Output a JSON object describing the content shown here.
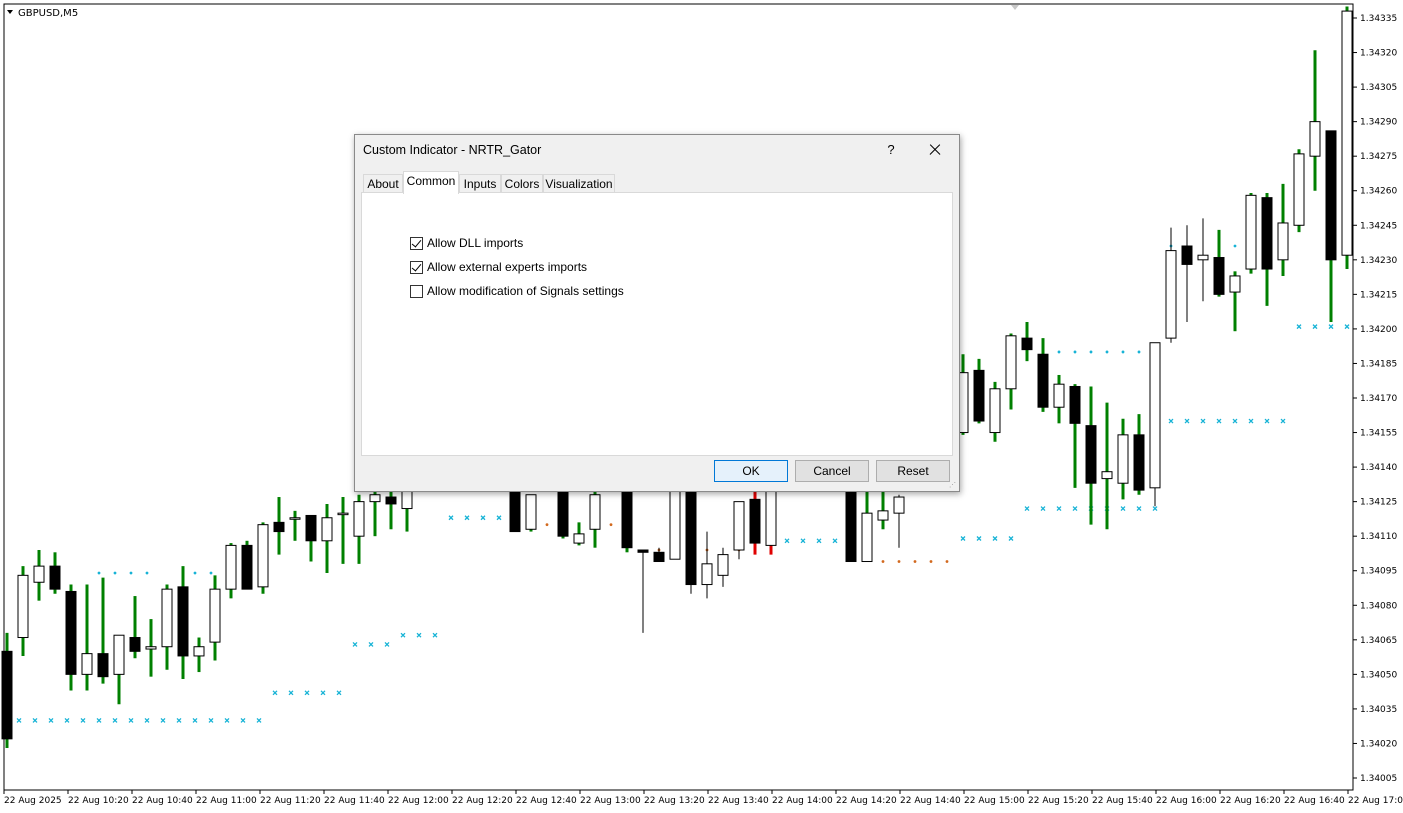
{
  "window": {
    "symbol_label": "GBPUSD,M5"
  },
  "price_axis": {
    "ticks": [
      "1.34335",
      "1.34320",
      "1.34305",
      "1.34290",
      "1.34275",
      "1.34260",
      "1.34245",
      "1.34230",
      "1.34215",
      "1.34200",
      "1.34185",
      "1.34170",
      "1.34155",
      "1.34140",
      "1.34125",
      "1.34110",
      "1.34095",
      "1.34080",
      "1.34065",
      "1.34050",
      "1.34035",
      "1.34020",
      "1.34005"
    ]
  },
  "time_axis": {
    "ticks": [
      "22 Aug 2025",
      "22 Aug 10:20",
      "22 Aug 10:40",
      "22 Aug 11:00",
      "22 Aug 11:20",
      "22 Aug 11:40",
      "22 Aug 12:00",
      "22 Aug 12:20",
      "22 Aug 12:40",
      "22 Aug 13:00",
      "22 Aug 13:20",
      "22 Aug 13:40",
      "22 Aug 14:00",
      "22 Aug 14:20",
      "22 Aug 14:40",
      "22 Aug 15:00",
      "22 Aug 15:20",
      "22 Aug 15:40",
      "22 Aug 16:00",
      "22 Aug 16:20",
      "22 Aug 16:40",
      "22 Aug 17:00"
    ]
  },
  "colors": {
    "wick_green": "#008000",
    "wick_red": "#e00000",
    "stop_marker": "#17b3d6",
    "dot_marker": "#d2691e"
  },
  "chart_data": {
    "type": "candlestick",
    "symbol": "GBPUSD",
    "timeframe": "M5",
    "ylim": [
      1.34,
      1.3434
    ],
    "candles": [
      {
        "o": 1.3406,
        "h": 1.34068,
        "l": 1.34018,
        "c": 1.34022,
        "w": "green"
      },
      {
        "o": 1.34066,
        "h": 1.34097,
        "l": 1.34058,
        "c": 1.34093,
        "w": "green"
      },
      {
        "o": 1.3409,
        "h": 1.34104,
        "l": 1.34082,
        "c": 1.34097,
        "w": "green"
      },
      {
        "o": 1.34097,
        "h": 1.34103,
        "l": 1.34085,
        "c": 1.34087,
        "w": "green"
      },
      {
        "o": 1.34086,
        "h": 1.34089,
        "l": 1.34043,
        "c": 1.3405,
        "w": "green"
      },
      {
        "o": 1.3405,
        "h": 1.34089,
        "l": 1.34043,
        "c": 1.34059,
        "w": "green"
      },
      {
        "o": 1.34059,
        "h": 1.34092,
        "l": 1.34046,
        "c": 1.34049,
        "w": "green"
      },
      {
        "o": 1.3405,
        "h": 1.34067,
        "l": 1.34037,
        "c": 1.34067,
        "w": "green"
      },
      {
        "o": 1.34066,
        "h": 1.34084,
        "l": 1.34057,
        "c": 1.3406,
        "w": "green"
      },
      {
        "o": 1.34061,
        "h": 1.34074,
        "l": 1.34049,
        "c": 1.34062,
        "w": "green"
      },
      {
        "o": 1.34062,
        "h": 1.34089,
        "l": 1.34052,
        "c": 1.34087,
        "w": "green"
      },
      {
        "o": 1.34088,
        "h": 1.34097,
        "l": 1.34048,
        "c": 1.34058,
        "w": "green"
      },
      {
        "o": 1.34058,
        "h": 1.34066,
        "l": 1.34051,
        "c": 1.34062,
        "w": "green"
      },
      {
        "o": 1.34064,
        "h": 1.34093,
        "l": 1.34056,
        "c": 1.34087,
        "w": "green"
      },
      {
        "o": 1.34087,
        "h": 1.34107,
        "l": 1.34083,
        "c": 1.34106,
        "w": "green"
      },
      {
        "o": 1.34106,
        "h": 1.34108,
        "l": 1.3409,
        "c": 1.34087,
        "w": "green"
      },
      {
        "o": 1.34088,
        "h": 1.34116,
        "l": 1.34085,
        "c": 1.34115,
        "w": "green"
      },
      {
        "o": 1.34116,
        "h": 1.34127,
        "l": 1.34102,
        "c": 1.34112,
        "w": "green"
      },
      {
        "o": 1.34118,
        "h": 1.34121,
        "l": 1.34108,
        "c": 1.34118,
        "w": "green"
      },
      {
        "o": 1.34119,
        "h": 1.34119,
        "l": 1.34099,
        "c": 1.34108,
        "w": "green"
      },
      {
        "o": 1.34108,
        "h": 1.34124,
        "l": 1.34094,
        "c": 1.34118,
        "w": "green"
      },
      {
        "o": 1.3412,
        "h": 1.34127,
        "l": 1.34098,
        "c": 1.3412,
        "w": "green"
      }
    ],
    "stop_marks_cross": [
      {
        "x": 19,
        "y": 1.3403
      },
      {
        "x": 35,
        "y": 1.3403
      },
      {
        "x": 51,
        "y": 1.3403
      },
      {
        "x": 67,
        "y": 1.3403
      },
      {
        "x": 83,
        "y": 1.3403
      },
      {
        "x": 99,
        "y": 1.3403
      },
      {
        "x": 115,
        "y": 1.3403
      },
      {
        "x": 131,
        "y": 1.3403
      },
      {
        "x": 147,
        "y": 1.3403
      },
      {
        "x": 163,
        "y": 1.3403
      },
      {
        "x": 179,
        "y": 1.3403
      },
      {
        "x": 195,
        "y": 1.3403
      },
      {
        "x": 211,
        "y": 1.3403
      },
      {
        "x": 227,
        "y": 1.3403
      },
      {
        "x": 243,
        "y": 1.3403
      },
      {
        "x": 259,
        "y": 1.3403
      },
      {
        "x": 275,
        "y": 1.34042
      },
      {
        "x": 291,
        "y": 1.34042
      },
      {
        "x": 307,
        "y": 1.34042
      },
      {
        "x": 323,
        "y": 1.34042
      },
      {
        "x": 339,
        "y": 1.34042
      },
      {
        "x": 355,
        "y": 1.34063
      },
      {
        "x": 371,
        "y": 1.34063
      },
      {
        "x": 387,
        "y": 1.34063
      },
      {
        "x": 403,
        "y": 1.34067
      },
      {
        "x": 419,
        "y": 1.34067
      },
      {
        "x": 435,
        "y": 1.34067
      },
      {
        "x": 451,
        "y": 1.34118
      },
      {
        "x": 467,
        "y": 1.34118
      },
      {
        "x": 483,
        "y": 1.34118
      },
      {
        "x": 499,
        "y": 1.34118
      },
      {
        "x": 787,
        "y": 1.34108
      },
      {
        "x": 803,
        "y": 1.34108
      },
      {
        "x": 819,
        "y": 1.34108
      },
      {
        "x": 835,
        "y": 1.34108
      },
      {
        "x": 963,
        "y": 1.34109
      },
      {
        "x": 979,
        "y": 1.34109
      },
      {
        "x": 995,
        "y": 1.34109
      },
      {
        "x": 1011,
        "y": 1.34109
      },
      {
        "x": 1027,
        "y": 1.34122
      },
      {
        "x": 1043,
        "y": 1.34122
      },
      {
        "x": 1059,
        "y": 1.34122
      },
      {
        "x": 1075,
        "y": 1.34122
      },
      {
        "x": 1091,
        "y": 1.34122
      },
      {
        "x": 1107,
        "y": 1.34122
      },
      {
        "x": 1123,
        "y": 1.34122
      },
      {
        "x": 1139,
        "y": 1.34122
      },
      {
        "x": 1155,
        "y": 1.34122
      },
      {
        "x": 1171,
        "y": 1.3416
      },
      {
        "x": 1187,
        "y": 1.3416
      },
      {
        "x": 1203,
        "y": 1.3416
      },
      {
        "x": 1219,
        "y": 1.3416
      },
      {
        "x": 1235,
        "y": 1.3416
      },
      {
        "x": 1251,
        "y": 1.3416
      },
      {
        "x": 1267,
        "y": 1.3416
      },
      {
        "x": 1283,
        "y": 1.3416
      },
      {
        "x": 1299,
        "y": 1.34201
      },
      {
        "x": 1315,
        "y": 1.34201
      },
      {
        "x": 1331,
        "y": 1.34201
      },
      {
        "x": 1347,
        "y": 1.34201
      }
    ],
    "stop_marks_dot": [
      {
        "x": 99,
        "y": 1.34094,
        "c": "cyan"
      },
      {
        "x": 115,
        "y": 1.34094,
        "c": "cyan"
      },
      {
        "x": 131,
        "y": 1.34094,
        "c": "cyan"
      },
      {
        "x": 147,
        "y": 1.34094,
        "c": "cyan"
      },
      {
        "x": 195,
        "y": 1.34094,
        "c": "cyan"
      },
      {
        "x": 211,
        "y": 1.34094,
        "c": "cyan"
      },
      {
        "x": 547,
        "y": 1.34115,
        "c": "orange"
      },
      {
        "x": 611,
        "y": 1.34115,
        "c": "orange"
      },
      {
        "x": 659,
        "y": 1.34104,
        "c": "orange"
      },
      {
        "x": 675,
        "y": 1.34104,
        "c": "orange"
      },
      {
        "x": 691,
        "y": 1.34104,
        "c": "orange"
      },
      {
        "x": 707,
        "y": 1.34104,
        "c": "orange"
      },
      {
        "x": 739,
        "y": 1.34104,
        "c": "orange"
      },
      {
        "x": 883,
        "y": 1.34099,
        "c": "orange"
      },
      {
        "x": 899,
        "y": 1.34099,
        "c": "orange"
      },
      {
        "x": 915,
        "y": 1.34099,
        "c": "orange"
      },
      {
        "x": 931,
        "y": 1.34099,
        "c": "orange"
      },
      {
        "x": 947,
        "y": 1.34099,
        "c": "orange"
      },
      {
        "x": 1059,
        "y": 1.3419,
        "c": "cyan"
      },
      {
        "x": 1075,
        "y": 1.3419,
        "c": "cyan"
      },
      {
        "x": 1091,
        "y": 1.3419,
        "c": "cyan"
      },
      {
        "x": 1107,
        "y": 1.3419,
        "c": "cyan"
      },
      {
        "x": 1123,
        "y": 1.3419,
        "c": "cyan"
      },
      {
        "x": 1139,
        "y": 1.3419,
        "c": "cyan"
      },
      {
        "x": 1171,
        "y": 1.34236,
        "c": "cyan"
      },
      {
        "x": 1235,
        "y": 1.34236,
        "c": "cyan"
      },
      {
        "x": 1267,
        "y": 1.34236,
        "c": "cyan"
      }
    ],
    "candles_right": [
      {
        "x": 515,
        "o": 1.3413,
        "h": 1.34135,
        "l": 1.34112,
        "c": 1.34112,
        "w": "green"
      },
      {
        "x": 531,
        "o": 1.34113,
        "h": 1.34128,
        "l": 1.34112,
        "c": 1.34128,
        "w": "green"
      },
      {
        "x": 563,
        "o": 1.3413,
        "h": 1.3413,
        "l": 1.34109,
        "c": 1.3411,
        "w": "green"
      },
      {
        "x": 579,
        "o": 1.34107,
        "h": 1.34116,
        "l": 1.34106,
        "c": 1.34111,
        "w": "green"
      },
      {
        "x": 595,
        "o": 1.34113,
        "h": 1.3413,
        "l": 1.34105,
        "c": 1.34128,
        "w": "green"
      },
      {
        "x": 627,
        "o": 1.3413,
        "h": 1.3413,
        "l": 1.34103,
        "c": 1.34105,
        "w": "green"
      },
      {
        "x": 643,
        "o": 1.34104,
        "h": 1.34104,
        "l": 1.34068,
        "c": 1.34103,
        "w": "black"
      },
      {
        "x": 659,
        "o": 1.34103,
        "h": 1.34105,
        "l": 1.34099,
        "c": 1.34099,
        "w": "black"
      },
      {
        "x": 675,
        "o": 1.341,
        "h": 1.3413,
        "l": 1.341,
        "c": 1.3413,
        "w": "black"
      },
      {
        "x": 691,
        "o": 1.3413,
        "h": 1.3413,
        "l": 1.34085,
        "c": 1.34089,
        "w": "black"
      },
      {
        "x": 707,
        "o": 1.34089,
        "h": 1.34112,
        "l": 1.34083,
        "c": 1.34098,
        "w": "black"
      },
      {
        "x": 723,
        "o": 1.34093,
        "h": 1.34105,
        "l": 1.34088,
        "c": 1.34102,
        "w": "black"
      },
      {
        "x": 739,
        "o": 1.34104,
        "h": 1.34125,
        "l": 1.341,
        "c": 1.34125,
        "w": "black"
      },
      {
        "x": 755,
        "o": 1.34126,
        "h": 1.3413,
        "l": 1.34102,
        "c": 1.34107,
        "w": "red"
      },
      {
        "x": 771,
        "o": 1.34106,
        "h": 1.3413,
        "l": 1.34102,
        "c": 1.3413,
        "w": "red"
      },
      {
        "x": 851,
        "o": 1.3413,
        "h": 1.3413,
        "l": 1.34099,
        "c": 1.34099,
        "w": "green"
      },
      {
        "x": 867,
        "o": 1.34099,
        "h": 1.3413,
        "l": 1.34099,
        "c": 1.3412,
        "w": "green"
      },
      {
        "x": 883,
        "o": 1.34117,
        "h": 1.3413,
        "l": 1.34113,
        "c": 1.34121,
        "w": "green"
      },
      {
        "x": 899,
        "o": 1.3412,
        "h": 1.34128,
        "l": 1.34105,
        "c": 1.34127,
        "w": "black"
      },
      {
        "x": 963,
        "o": 1.34155,
        "h": 1.34189,
        "l": 1.34154,
        "c": 1.34181,
        "w": "green"
      },
      {
        "x": 979,
        "o": 1.34182,
        "h": 1.34187,
        "l": 1.34159,
        "c": 1.3416,
        "w": "green"
      },
      {
        "x": 995,
        "o": 1.34155,
        "h": 1.34177,
        "l": 1.34151,
        "c": 1.34174,
        "w": "green"
      },
      {
        "x": 1011,
        "o": 1.34174,
        "h": 1.34198,
        "l": 1.34165,
        "c": 1.34197,
        "w": "green"
      },
      {
        "x": 1027,
        "o": 1.34196,
        "h": 1.34203,
        "l": 1.34186,
        "c": 1.34191,
        "w": "green"
      },
      {
        "x": 1043,
        "o": 1.34189,
        "h": 1.34196,
        "l": 1.34164,
        "c": 1.34166,
        "w": "green"
      },
      {
        "x": 1059,
        "o": 1.34166,
        "h": 1.3418,
        "l": 1.34159,
        "c": 1.34176,
        "w": "green"
      },
      {
        "x": 1075,
        "o": 1.34175,
        "h": 1.34176,
        "l": 1.34131,
        "c": 1.34159,
        "w": "green"
      },
      {
        "x": 1091,
        "o": 1.34158,
        "h": 1.34175,
        "l": 1.34115,
        "c": 1.34133,
        "w": "green"
      },
      {
        "x": 1107,
        "o": 1.34135,
        "h": 1.34168,
        "l": 1.34113,
        "c": 1.34138,
        "w": "green"
      },
      {
        "x": 1123,
        "o": 1.34133,
        "h": 1.34161,
        "l": 1.34126,
        "c": 1.34154,
        "w": "green"
      },
      {
        "x": 1139,
        "o": 1.34154,
        "h": 1.34163,
        "l": 1.34128,
        "c": 1.3413,
        "w": "green"
      },
      {
        "x": 1155,
        "o": 1.34131,
        "h": 1.34194,
        "l": 1.34123,
        "c": 1.34194,
        "w": "black"
      },
      {
        "x": 1171,
        "o": 1.34196,
        "h": 1.34244,
        "l": 1.34194,
        "c": 1.34234,
        "w": "black"
      },
      {
        "x": 1187,
        "o": 1.34236,
        "h": 1.34245,
        "l": 1.34203,
        "c": 1.34228,
        "w": "black"
      },
      {
        "x": 1203,
        "o": 1.3423,
        "h": 1.34248,
        "l": 1.34212,
        "c": 1.34232,
        "w": "black"
      },
      {
        "x": 1219,
        "o": 1.34231,
        "h": 1.34243,
        "l": 1.34214,
        "c": 1.34215,
        "w": "green"
      },
      {
        "x": 1235,
        "o": 1.34216,
        "h": 1.34225,
        "l": 1.34199,
        "c": 1.34223,
        "w": "green"
      },
      {
        "x": 1251,
        "o": 1.34226,
        "h": 1.34259,
        "l": 1.34224,
        "c": 1.34258,
        "w": "green"
      },
      {
        "x": 1267,
        "o": 1.34257,
        "h": 1.34259,
        "l": 1.3421,
        "c": 1.34226,
        "w": "green"
      },
      {
        "x": 1283,
        "o": 1.3423,
        "h": 1.34263,
        "l": 1.34223,
        "c": 1.34246,
        "w": "green"
      },
      {
        "x": 1299,
        "o": 1.34245,
        "h": 1.34278,
        "l": 1.34242,
        "c": 1.34276,
        "w": "green"
      },
      {
        "x": 1315,
        "o": 1.34275,
        "h": 1.34321,
        "l": 1.3426,
        "c": 1.3429,
        "w": "green"
      },
      {
        "x": 1331,
        "o": 1.34286,
        "h": 1.34286,
        "l": 1.34203,
        "c": 1.3423,
        "w": "green"
      },
      {
        "x": 1347,
        "o": 1.34232,
        "h": 1.3434,
        "l": 1.34226,
        "c": 1.34338,
        "w": "green"
      }
    ]
  },
  "dialog": {
    "title": "Custom Indicator - NRTR_Gator",
    "help_label": "?",
    "tabs": [
      {
        "label": "About"
      },
      {
        "label": "Common"
      },
      {
        "label": "Inputs"
      },
      {
        "label": "Colors"
      },
      {
        "label": "Visualization"
      }
    ],
    "active_tab": "Common",
    "options": [
      {
        "label": "Allow DLL imports",
        "checked": true
      },
      {
        "label": "Allow external experts imports",
        "checked": true
      },
      {
        "label": "Allow modification of Signals settings",
        "checked": false
      }
    ],
    "buttons": {
      "ok": "OK",
      "cancel": "Cancel",
      "reset": "Reset"
    }
  }
}
